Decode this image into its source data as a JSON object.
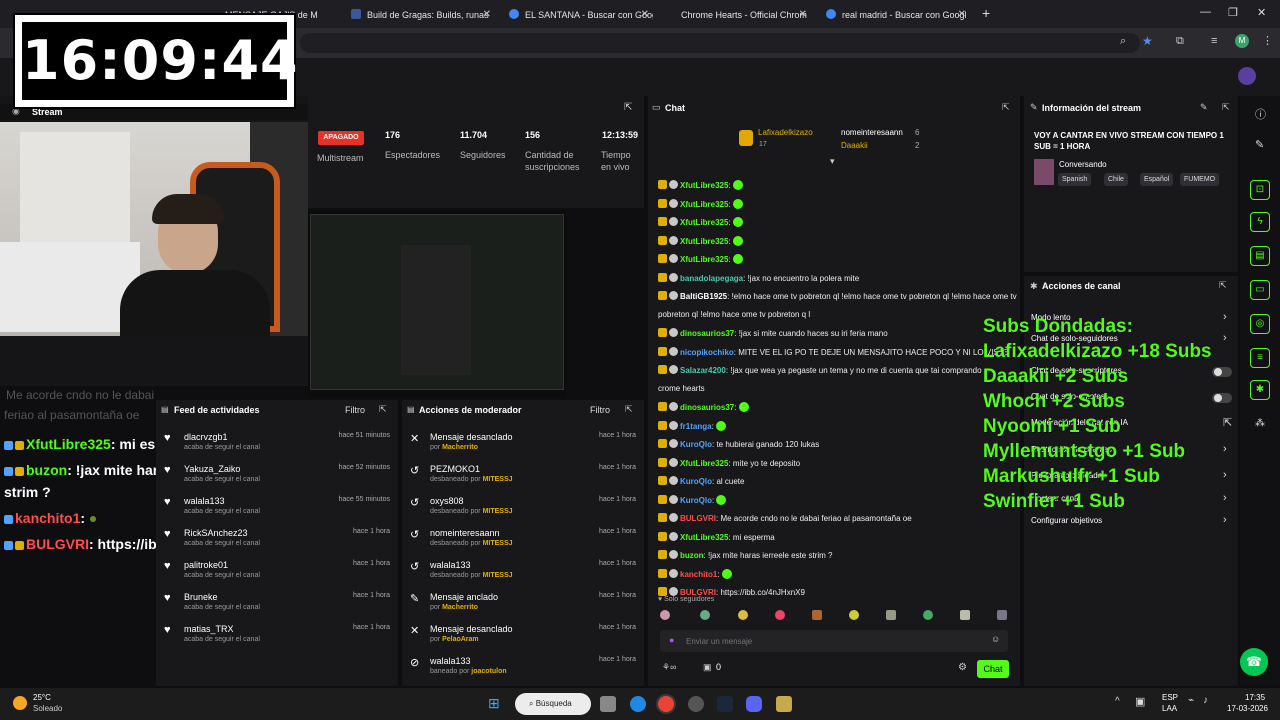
{
  "browser": {
    "tabs": [
      {
        "label": "MENSAJE GAJ'S de M",
        "color": "#2a2a2a"
      },
      {
        "label": "Build de Gragas: Builds, runas",
        "color": "#3b5998"
      },
      {
        "label": "EL SANTANA - Buscar con Goog",
        "color": "#4285f4"
      },
      {
        "label": "Chrome Hearts - Official Chrom",
        "color": "#555555"
      },
      {
        "label": "real madrid - Buscar con Googl",
        "color": "#4285f4"
      }
    ],
    "new_tab": "+",
    "profile_initial": "M"
  },
  "overlay": {
    "clock": "16:09:44",
    "chat": [
      {
        "user": "XfutLibre325",
        "msg": ": mi esperma",
        "color": "#53fc18"
      },
      {
        "user": "buzon",
        "msg": ": !jax mite haras ierreele este",
        "color": "#53fc18"
      },
      {
        "user": "",
        "msg": "strim ?",
        "color": "#ffffff"
      },
      {
        "user": "kanchito1",
        "msg": ": ",
        "color": "#ff4d4d"
      },
      {
        "user": "BULGVRI",
        "msg": ": https://ibb.co/4nJHxnX9",
        "color": "#ff4d4d"
      }
    ],
    "faded_chat": [
      "Me acorde cndo no le dabai",
      "feriao al pasamontaña oe"
    ]
  },
  "stream_panel": {
    "title": "Stream",
    "status_badge": "APAGADO",
    "multistream": "Multistream",
    "stats": [
      {
        "value": "176",
        "label": "Espectadores"
      },
      {
        "value": "11.704",
        "label": "Seguidores"
      },
      {
        "value": "156",
        "label": "Cantidad de suscripciones"
      },
      {
        "value": "12:13:59",
        "label": "Tiempo en vivo"
      }
    ]
  },
  "feed": {
    "title": "Feed de actividades",
    "filter": "Filtro",
    "items": [
      {
        "name": "dlacrvzgb1",
        "sub": "acaba de seguir el canal",
        "time": "hace 51 minutos"
      },
      {
        "name": "Yakuza_Zaiko",
        "sub": "acaba de seguir el canal",
        "time": "hace 52 minutos"
      },
      {
        "name": "walala133",
        "sub": "acaba de seguir el canal",
        "time": "hace 55 minutos"
      },
      {
        "name": "RickSAnchez23",
        "sub": "acaba de seguir el canal",
        "time": "hace 1 hora"
      },
      {
        "name": "palitroke01",
        "sub": "acaba de seguir el canal",
        "time": "hace 1 hora"
      },
      {
        "name": "Bruneke",
        "sub": "acaba de seguir el canal",
        "time": "hace 1 hora"
      },
      {
        "name": "matias_TRX",
        "sub": "acaba de seguir el canal",
        "time": "hace 1 hora"
      }
    ]
  },
  "mod": {
    "title": "Acciones de moderador",
    "filter": "Filtro",
    "items": [
      {
        "icon": "unpin-icon",
        "glyph": "✕",
        "action": "Mensaje desanclado",
        "by_prefix": "por",
        "by": "Macherrito",
        "time": "hace 1 hora"
      },
      {
        "icon": "unban-icon",
        "glyph": "↺",
        "action": "PEZMOKO1",
        "by_prefix": "desbaneado por",
        "by": "MITESSJ",
        "time": "hace 1 hora"
      },
      {
        "icon": "unban-icon",
        "glyph": "↺",
        "action": "oxys808",
        "by_prefix": "desbaneado por",
        "by": "MITESSJ",
        "time": "hace 1 hora"
      },
      {
        "icon": "unban-icon",
        "glyph": "↺",
        "action": "nomeinteresaann",
        "by_prefix": "desbaneado por",
        "by": "MITESSJ",
        "time": "hace 1 hora"
      },
      {
        "icon": "unban-icon",
        "glyph": "↺",
        "action": "walala133",
        "by_prefix": "desbaneado por",
        "by": "MITESSJ",
        "time": "hace 1 hora"
      },
      {
        "icon": "pin-icon",
        "glyph": "✎",
        "action": "Mensaje anclado",
        "by_prefix": "por",
        "by": "Macherrito",
        "time": "hace 1 hora"
      },
      {
        "icon": "unpin-icon",
        "glyph": "✕",
        "action": "Mensaje desanclado",
        "by_prefix": "por",
        "by": "PelaoAram",
        "time": "hace 1 hora"
      },
      {
        "icon": "ban-icon",
        "glyph": "⊘",
        "action": "walala133",
        "by_prefix": "baneado por",
        "by": "joacotulon",
        "time": "hace 1 hora"
      }
    ]
  },
  "chat": {
    "title": "Chat",
    "top_gifters": [
      {
        "name": "Lafixadelkizazo",
        "count": "17"
      },
      {
        "name": "nomeinteresaann",
        "count": "6"
      },
      {
        "name": "Daaakii",
        "count": "2"
      }
    ],
    "messages": [
      {
        "user": "XfutLibre325",
        "text": ":",
        "ucolor": "#53fc18"
      },
      {
        "user": "XfutLibre325",
        "text": ":",
        "ucolor": "#53fc18"
      },
      {
        "user": "XfutLibre325",
        "text": ":",
        "ucolor": "#53fc18"
      },
      {
        "user": "XfutLibre325",
        "text": ":",
        "ucolor": "#53fc18"
      },
      {
        "user": "XfutLibre325",
        "text": ":",
        "ucolor": "#53fc18"
      },
      {
        "user": "banadolapegaga",
        "text": ": !jax no encuentro la polera mite",
        "ucolor": "#4ec9b0"
      },
      {
        "user": "BaltiGB1925",
        "text": ": !elmo hace ome tv pobreton ql !elmo hace ome tv pobreton ql !elmo hace ome tv",
        "ucolor": "#ffffff"
      },
      {
        "user": "",
        "text": "pobreton ql !elmo hace ome tv pobreton q l",
        "ucolor": "#ffffff"
      },
      {
        "user": "dinosaurios37",
        "text": ": !jax si mite cuando haces su iri feria mano",
        "ucolor": "#53fc18"
      },
      {
        "user": "nicopikochiko",
        "text": ": MITE VE EL IG PO TE DEJE UN MENSAJITO HACE POCO Y NI LO VISTE",
        "ucolor": "#4fa3ff"
      },
      {
        "user": "Salazar4200",
        "text": ": !jax que wea ya pegaste un tema y no me di cuenta que tai comprando",
        "ucolor": "#4ec9b0"
      },
      {
        "user": "",
        "text": "crome hearts",
        "ucolor": "#ffffff"
      },
      {
        "user": "dinosaurios37",
        "text": ":",
        "ucolor": "#53fc18"
      },
      {
        "user": "fr1tanga",
        "text": ":",
        "ucolor": "#4fa3ff"
      },
      {
        "user": "KuroQlo",
        "text": ": te hubierai ganado 120 lukas",
        "ucolor": "#4fa3ff"
      },
      {
        "user": "XfutLibre325",
        "text": ": mite yo te deposito",
        "ucolor": "#53fc18"
      },
      {
        "user": "KuroQlo",
        "text": ": al cuete",
        "ucolor": "#4fa3ff"
      },
      {
        "user": "KuroQlo",
        "text": ":",
        "ucolor": "#4fa3ff"
      },
      {
        "user": "BULGVRI",
        "text": ": Me acorde cndo no le dabai feriao al pasamontaña oe",
        "ucolor": "#ff4d4d"
      },
      {
        "user": "XfutLibre325",
        "text": ": mi esperma",
        "ucolor": "#53fc18"
      },
      {
        "user": "buzon",
        "text": ": !jax mite haras ierreele este strim ?",
        "ucolor": "#53fc18"
      },
      {
        "user": "kanchito1",
        "text": ":",
        "ucolor": "#ff4d4d"
      },
      {
        "user": "BULGVRI",
        "text": ": https://ibb.co/4nJHxnX9",
        "ucolor": "#ff4d4d"
      }
    ],
    "mode_label": "Solo seguidores",
    "input_placeholder": "Enviar un mensaje",
    "counter": "0",
    "send_button": "Chat"
  },
  "stream_info": {
    "title": "Información del stream",
    "stream_title": "VOY A CANTAR EN VIVO STREAM CON TIEMPO 1 SUB = 1 HORA",
    "category": "Conversando",
    "tags": [
      "Spanish",
      "Chile",
      "Español",
      "FUMEMO"
    ]
  },
  "channel_actions": {
    "title": "Acciones de canal",
    "items": [
      {
        "label": "Modo lento",
        "control": "chevron"
      },
      {
        "label": "Chat de solo-seguidores",
        "control": "chevron"
      },
      {
        "label": "Chat de solo-suscriptores",
        "control": "toggle"
      },
      {
        "label": "Chat de solo-emotes",
        "control": "toggle"
      },
      {
        "label": "Moderación del chat con IA",
        "control": "link"
      },
      {
        "label": "Restricción de cuentas",
        "control": "chevron"
      },
      {
        "label": "Palabras bloqueadas",
        "control": "chevron"
      },
      {
        "label": "Hostear canal",
        "control": "chevron"
      },
      {
        "label": "Configurar objetivos",
        "control": "chevron"
      }
    ]
  },
  "subs_overlay": {
    "lines": [
      "Subs Dondadas:",
      "Lafixadelkizazo +18 Subs",
      "Daaakii +2 Subs",
      "Whoch +2 Subs",
      "Nyoomi +1 Sub",
      "Myllemuntstgo +1 Sub",
      "Markushulfr +1 Sub",
      "Swinfier +1 Sub"
    ]
  },
  "taskbar": {
    "weather_temp": "25°C",
    "weather_desc": "Soleado",
    "search": "Búsqueda",
    "lang": "ESP",
    "lang_sub": "LAA",
    "time": "17:35",
    "date": "17-03-2026"
  }
}
